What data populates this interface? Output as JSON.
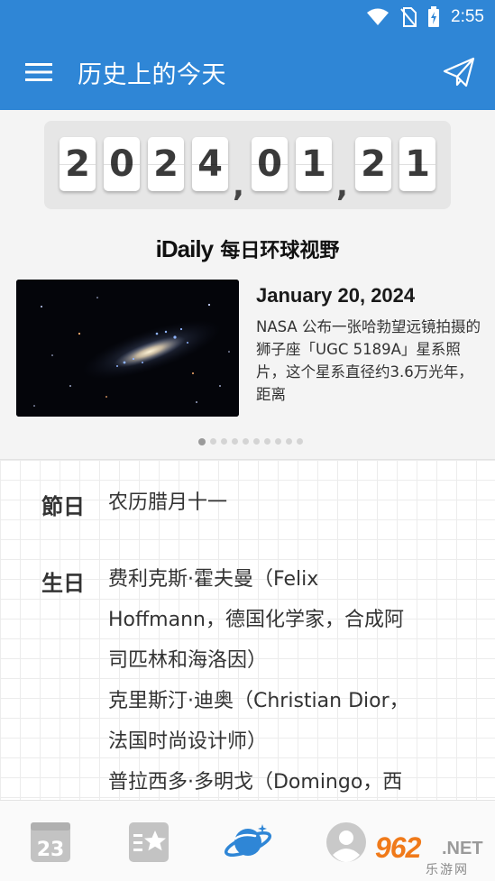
{
  "status_bar": {
    "time": "2:55"
  },
  "app_bar": {
    "title": "历史上的今天"
  },
  "date_counter": {
    "year_digits": [
      "2",
      "0",
      "2",
      "4"
    ],
    "month_digits": [
      "0",
      "1"
    ],
    "day_digits": [
      "2",
      "1"
    ],
    "separator": ","
  },
  "idaily": {
    "brand": "iDaily",
    "subtitle": "每日环球视野",
    "date": "January 20, 2024",
    "description": "NASA 公布一张哈勃望远镜拍摄的狮子座「UGC 5189A」星系照片，这个星系直径约3.6万光年，距离",
    "pager": {
      "total": 10,
      "active": 0
    }
  },
  "sections": [
    {
      "label": "節日",
      "lines": [
        "农历腊月十一"
      ]
    },
    {
      "label": "生日",
      "lines": [
        "费利克斯·霍夫曼（Felix",
        "Hoffmann，德国化学家，合成阿",
        "司匹林和海洛因）",
        "克里斯汀·迪奥（Christian Dior，",
        "法国时尚设计师）",
        "普拉西多·多明戈（Domingo，西"
      ]
    }
  ],
  "bottom_nav": {
    "items": [
      "calendar-icon",
      "favorites-icon",
      "planet-icon",
      "profile-icon"
    ],
    "calendar_day": "23",
    "active_index": 2
  },
  "watermark": {
    "number": "962",
    "suffix": ".NET",
    "subtitle": "乐游网"
  },
  "colors": {
    "primary": "#2f86d6",
    "active_nav": "#2f86d6",
    "inactive_nav": "#c3c3c3"
  }
}
